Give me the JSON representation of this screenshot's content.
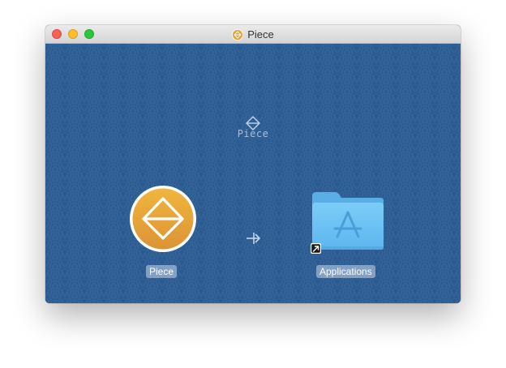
{
  "window": {
    "title": "Piece"
  },
  "installer": {
    "brand_name": "Piece",
    "app_label": "Piece",
    "target_label": "Applications"
  },
  "icons": {
    "title": "piece-logo-icon",
    "brand": "piece-logo-icon",
    "app": "piece-app-icon",
    "arrow": "arrow-right-icon",
    "target": "applications-folder-icon",
    "alias": "alias-arrow-icon"
  },
  "colors": {
    "background": "#2a5a8f",
    "app_icon_gold": "#e8a73a",
    "folder_blue": "#6ec3f5",
    "brand_text": "#a9bfd9"
  }
}
